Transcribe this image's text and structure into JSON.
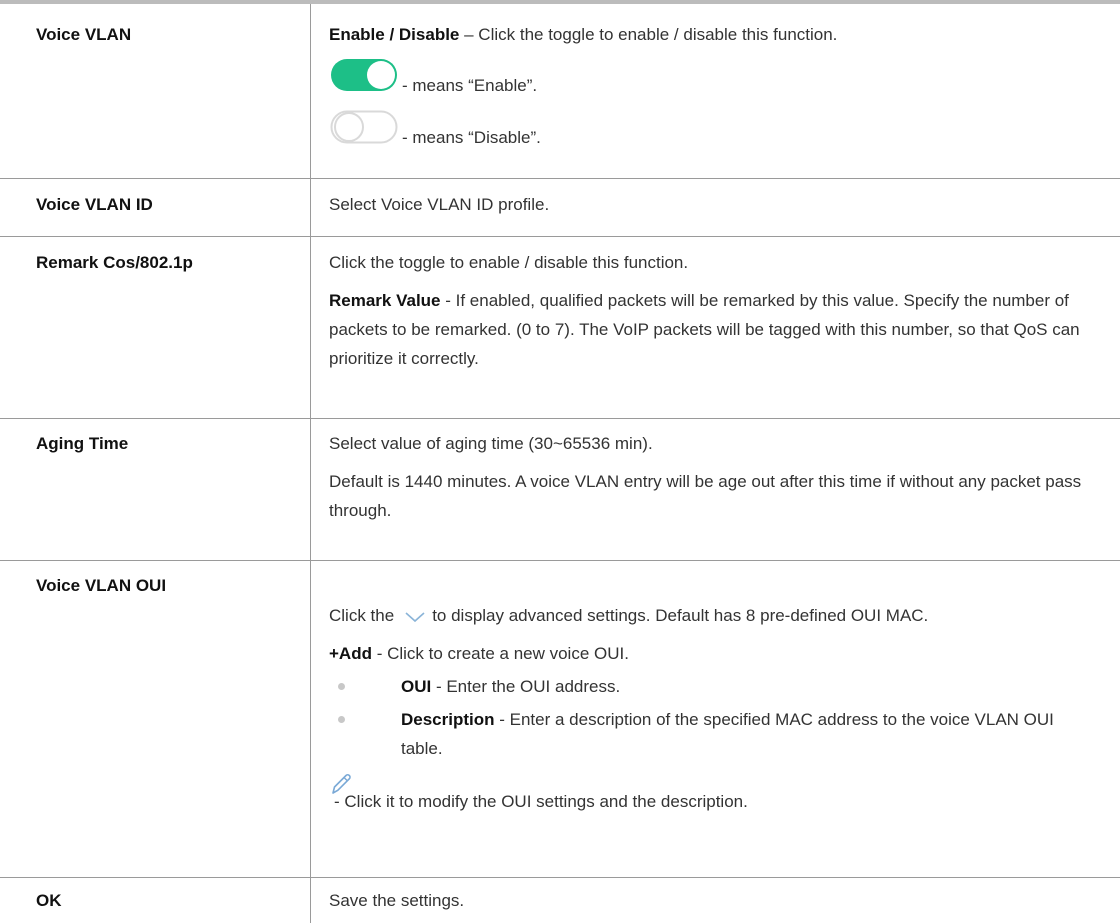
{
  "rows": [
    {
      "label": "Voice VLAN",
      "line1_bold": "Enable / Disable",
      "line1_text": " – Click the toggle to enable / disable this function.",
      "enable_text": "- means “Enable”.",
      "disable_text": "- means “Disable”.",
      "toggle_on_color": "#1dbf87",
      "toggle_on_icon": "toggle-on-icon",
      "toggle_off_icon": "toggle-off-icon"
    },
    {
      "label": "Voice VLAN ID",
      "text": "Select Voice VLAN ID profile."
    },
    {
      "label": "Remark Cos/802.1p",
      "text1": "Click the toggle to enable / disable this function.",
      "bold2": "Remark Value",
      "text2": " - If enabled, qualified packets will be remarked by this value. Specify the number of packets to be remarked. (0 to 7). The VoIP packets will be tagged with this number, so that QoS can prioritize it correctly."
    },
    {
      "label": "Aging Time",
      "text1": "Select value of aging time (30~65536 min).",
      "text2": "Default is 1440 minutes. A voice VLAN entry will be age out after this time if without any packet pass through."
    },
    {
      "label": "Voice VLAN OUI",
      "text1_a": "Click the",
      "chevron_icon": "chevron-down-icon",
      "text1_b": "to display advanced settings. Default has 8 pre-defined OUI MAC.",
      "add_bold": "+Add",
      "add_text": " - Click to create a new voice OUI.",
      "bullets": [
        {
          "bold": "OUI",
          "text": " - Enter the OUI address."
        },
        {
          "bold": "Description",
          "text": " - Enter a description of the specified MAC address to the voice VLAN OUI table."
        }
      ],
      "pencil_icon": "pencil-edit-icon",
      "pencil_text": " - Click it to modify the OUI settings and the description."
    },
    {
      "label": "OK",
      "text": "Save the settings."
    }
  ]
}
